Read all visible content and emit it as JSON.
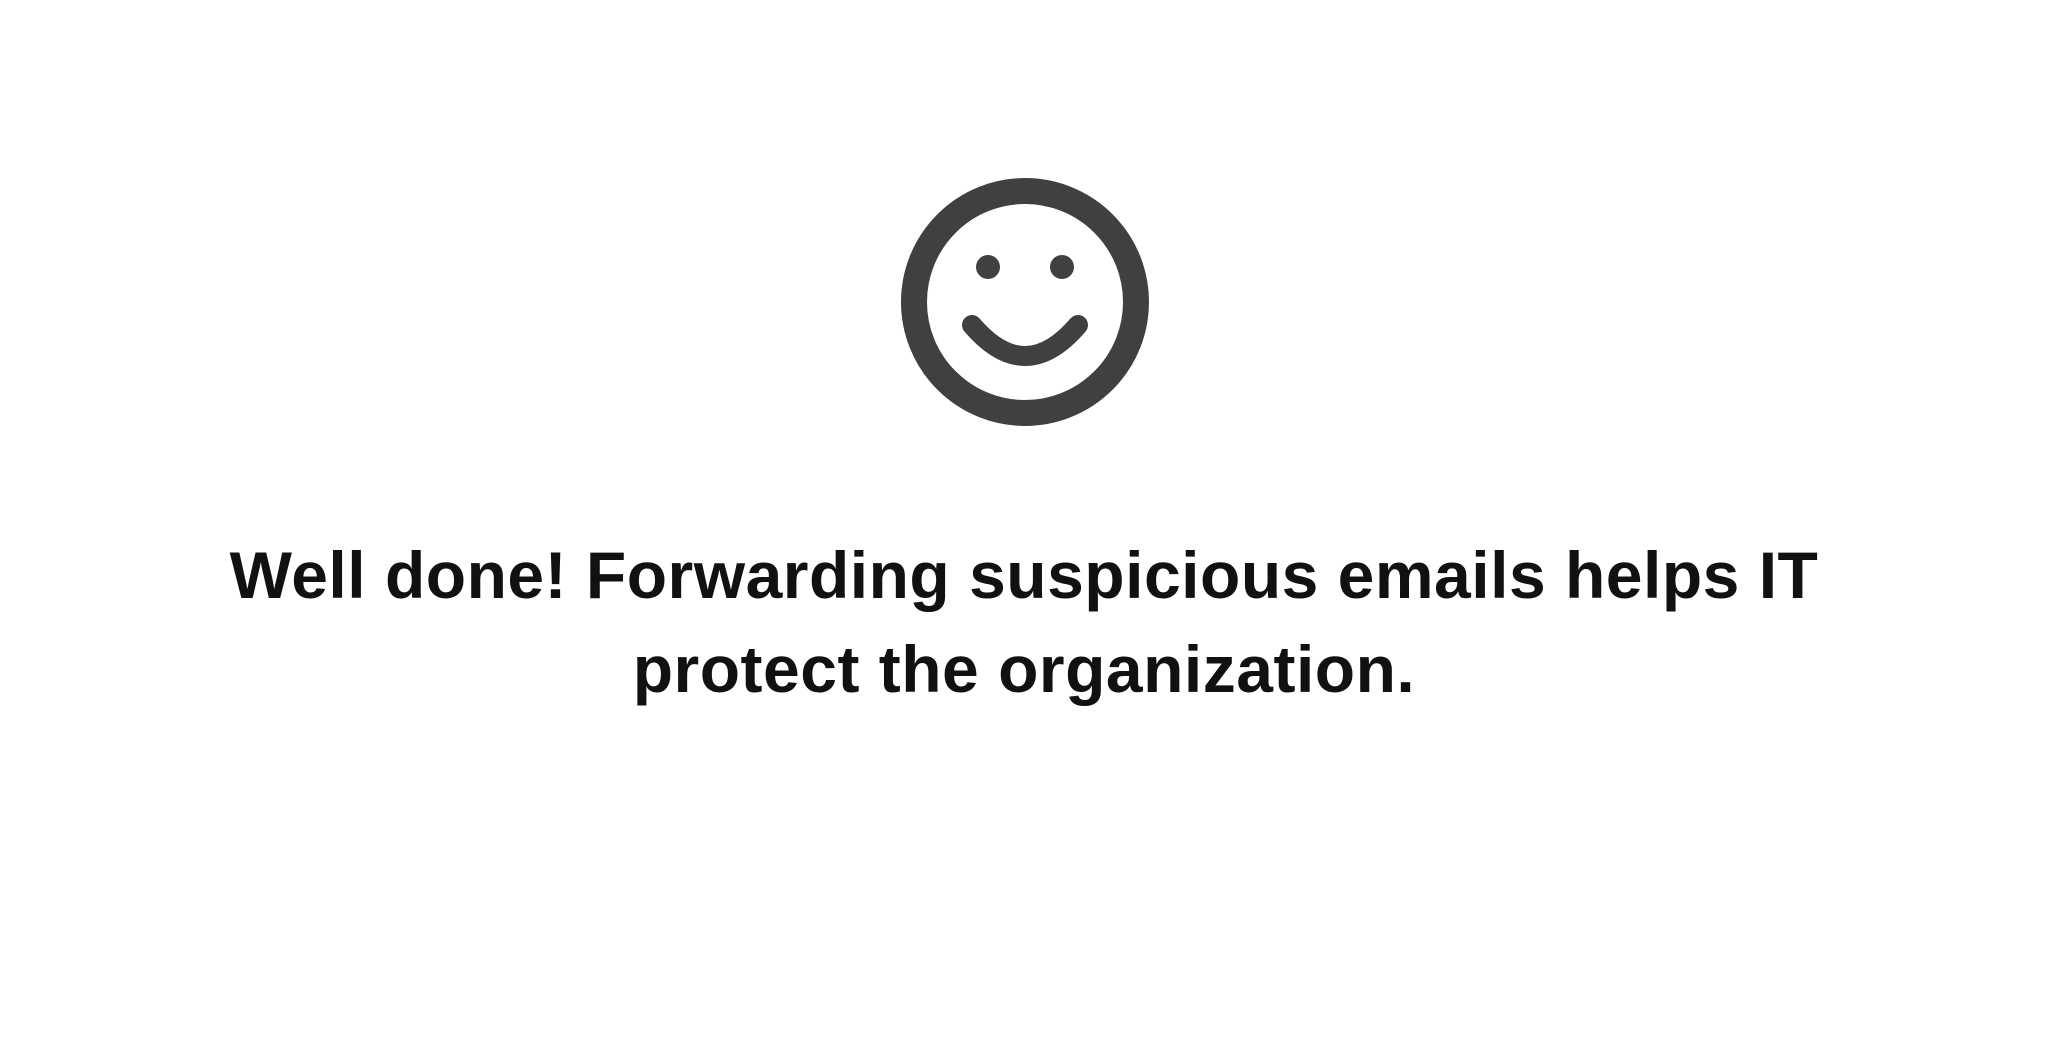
{
  "feedback": {
    "icon": "smiley-face-icon",
    "icon_color": "#404040",
    "message_lines": [
      "Well done! Forwarding suspicious emails helps IT",
      "protect the organization."
    ]
  }
}
